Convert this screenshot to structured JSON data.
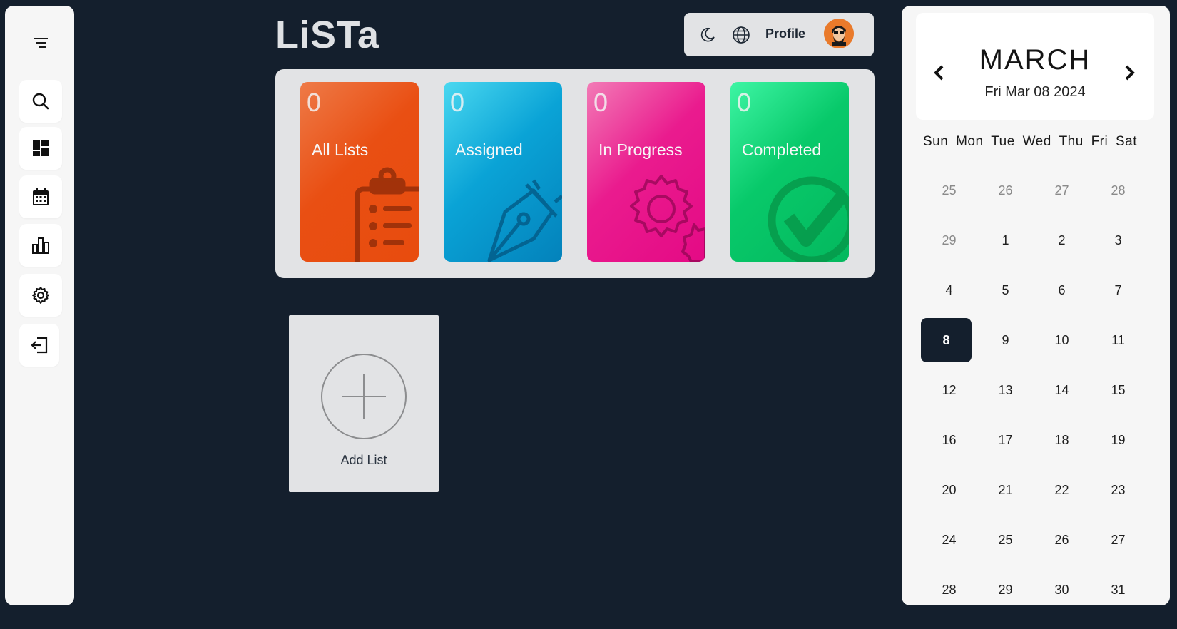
{
  "app": {
    "title": "LiSTa"
  },
  "sidebar": {
    "items": [
      {
        "name": "search",
        "icon": "search-icon"
      },
      {
        "name": "dashboard",
        "icon": "dashboard-icon"
      },
      {
        "name": "calendar",
        "icon": "calendar-icon"
      },
      {
        "name": "stats",
        "icon": "bar-chart-icon"
      },
      {
        "name": "settings",
        "icon": "gear-icon"
      },
      {
        "name": "logout",
        "icon": "logout-icon"
      }
    ]
  },
  "topbar": {
    "profile_label": "Profile"
  },
  "stats": {
    "cards": [
      {
        "count": "0",
        "label": "All Lists",
        "color": "#e94f13"
      },
      {
        "count": "0",
        "label": "Assigned",
        "color": "#0aa3d6"
      },
      {
        "count": "0",
        "label": "In Progress",
        "color": "#ea1b8e"
      },
      {
        "count": "0",
        "label": "Completed",
        "color": "#08c96a"
      }
    ]
  },
  "add_list": {
    "label": "Add List"
  },
  "calendar": {
    "month": "MARCH",
    "date_label": "Fri Mar 08 2024",
    "weekdays": [
      "Sun",
      "Mon",
      "Tue",
      "Wed",
      "Thu",
      "Fri",
      "Sat"
    ],
    "days": [
      {
        "d": "25",
        "muted": true
      },
      {
        "d": "26",
        "muted": true
      },
      {
        "d": "27",
        "muted": true
      },
      {
        "d": "28",
        "muted": true
      },
      {
        "d": "29",
        "muted": true
      },
      {
        "d": "1"
      },
      {
        "d": "2"
      },
      {
        "d": "3"
      },
      {
        "d": "4"
      },
      {
        "d": "5"
      },
      {
        "d": "6"
      },
      {
        "d": "7"
      },
      {
        "d": "8",
        "today": true
      },
      {
        "d": "9"
      },
      {
        "d": "10"
      },
      {
        "d": "11"
      },
      {
        "d": "12"
      },
      {
        "d": "13"
      },
      {
        "d": "14"
      },
      {
        "d": "15"
      },
      {
        "d": "16"
      },
      {
        "d": "17"
      },
      {
        "d": "18"
      },
      {
        "d": "19"
      },
      {
        "d": "20"
      },
      {
        "d": "21"
      },
      {
        "d": "22"
      },
      {
        "d": "23"
      },
      {
        "d": "24"
      },
      {
        "d": "25"
      },
      {
        "d": "26"
      },
      {
        "d": "27"
      },
      {
        "d": "28"
      },
      {
        "d": "29"
      },
      {
        "d": "30"
      },
      {
        "d": "31"
      }
    ]
  }
}
